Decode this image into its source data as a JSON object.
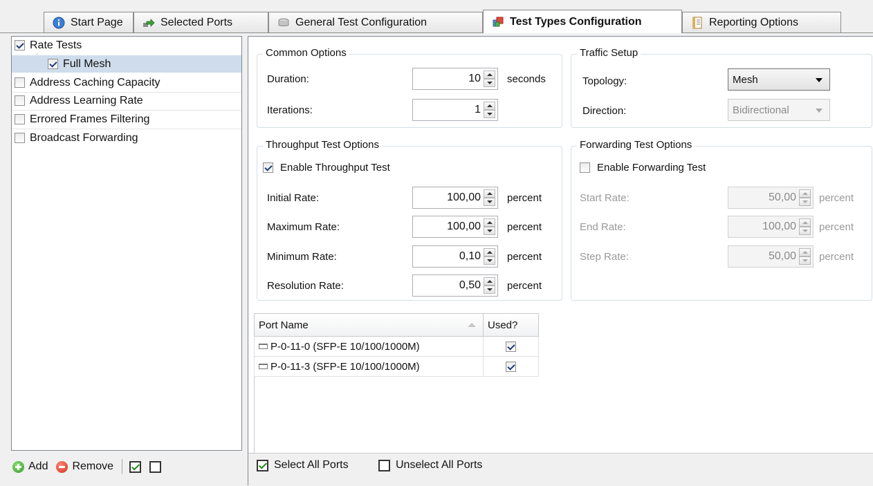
{
  "tabs": [
    {
      "label": "Start Page",
      "icon": "info-icon",
      "active": false
    },
    {
      "label": "Selected Ports",
      "icon": "ports-arrow-icon",
      "active": false
    },
    {
      "label": "General Test Configuration",
      "icon": "config-box-icon",
      "active": false
    },
    {
      "label": "Test Types Configuration",
      "icon": "test-types-icon",
      "active": true
    },
    {
      "label": "Reporting Options",
      "icon": "report-icon",
      "active": false
    }
  ],
  "tree": {
    "items": [
      {
        "label": "Rate Tests",
        "checked": true,
        "level": 0
      },
      {
        "label": "Full Mesh",
        "checked": true,
        "level": 1,
        "selected": true
      },
      {
        "label": "Address Caching Capacity",
        "checked": false,
        "level": 0
      },
      {
        "label": "Address Learning Rate",
        "checked": false,
        "level": 0
      },
      {
        "label": "Errored Frames Filtering",
        "checked": false,
        "level": 0
      },
      {
        "label": "Broadcast Forwarding",
        "checked": false,
        "level": 0
      }
    ]
  },
  "left_toolbar": {
    "add_label": "Add",
    "remove_label": "Remove",
    "check_all": true,
    "uncheck_all": false
  },
  "common": {
    "title": "Common Options",
    "duration_label": "Duration:",
    "duration_value": "10",
    "duration_unit": "seconds",
    "iterations_label": "Iterations:",
    "iterations_value": "1"
  },
  "traffic": {
    "title": "Traffic Setup",
    "topology_label": "Topology:",
    "topology_value": "Mesh",
    "direction_label": "Direction:",
    "direction_value": "Bidirectional"
  },
  "throughput": {
    "title": "Throughput Test Options",
    "enable_label": "Enable Throughput Test",
    "enabled": true,
    "initial_label": "Initial Rate:",
    "initial_value": "100,00",
    "maximum_label": "Maximum Rate:",
    "maximum_value": "100,00",
    "minimum_label": "Minimum Rate:",
    "minimum_value": "0,10",
    "resolution_label": "Resolution Rate:",
    "resolution_value": "0,50",
    "unit": "percent"
  },
  "forwarding": {
    "title": "Forwarding Test Options",
    "enable_label": "Enable Forwarding Test",
    "enabled": false,
    "start_label": "Start Rate:",
    "start_value": "50,00",
    "end_label": "End Rate:",
    "end_value": "100,00",
    "step_label": "Step Rate:",
    "step_value": "50,00",
    "unit": "percent"
  },
  "ports": {
    "headers": {
      "name": "Port Name",
      "used": "Used?"
    },
    "rows": [
      {
        "name": "P-0-11-0 (SFP-E 10/100/1000M)",
        "used": true
      },
      {
        "name": "P-0-11-3 (SFP-E 10/100/1000M)",
        "used": true
      }
    ]
  },
  "bottom": {
    "select_all": "Select All Ports",
    "unselect_all": "Unselect All Ports"
  }
}
